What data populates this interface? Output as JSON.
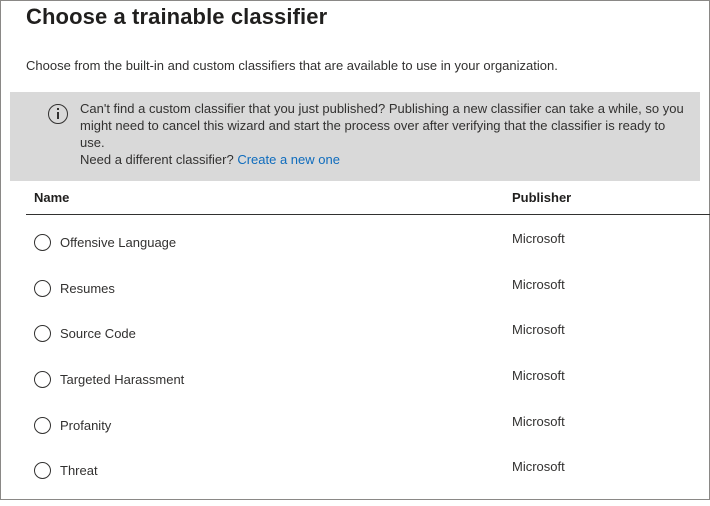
{
  "title": "Choose a trainable classifier",
  "description": "Choose from the built-in and custom classifiers that are available to use in your organization.",
  "banner": {
    "icon": "info-icon",
    "message": "Can't find a custom classifier that you just published? Publishing a new classifier can take a while, so you might need to cancel this wizard and start the process over after verifying that the classifier is ready to use.",
    "prompt": "Need a different classifier?",
    "link_label": "Create a new one"
  },
  "table": {
    "columns": [
      "Name",
      "Publisher"
    ],
    "rows": [
      {
        "name": "Offensive Language",
        "publisher": "Microsoft"
      },
      {
        "name": "Resumes",
        "publisher": "Microsoft"
      },
      {
        "name": "Source Code",
        "publisher": "Microsoft"
      },
      {
        "name": "Targeted Harassment",
        "publisher": "Microsoft"
      },
      {
        "name": "Profanity",
        "publisher": "Microsoft"
      },
      {
        "name": "Threat",
        "publisher": "Microsoft"
      }
    ]
  }
}
